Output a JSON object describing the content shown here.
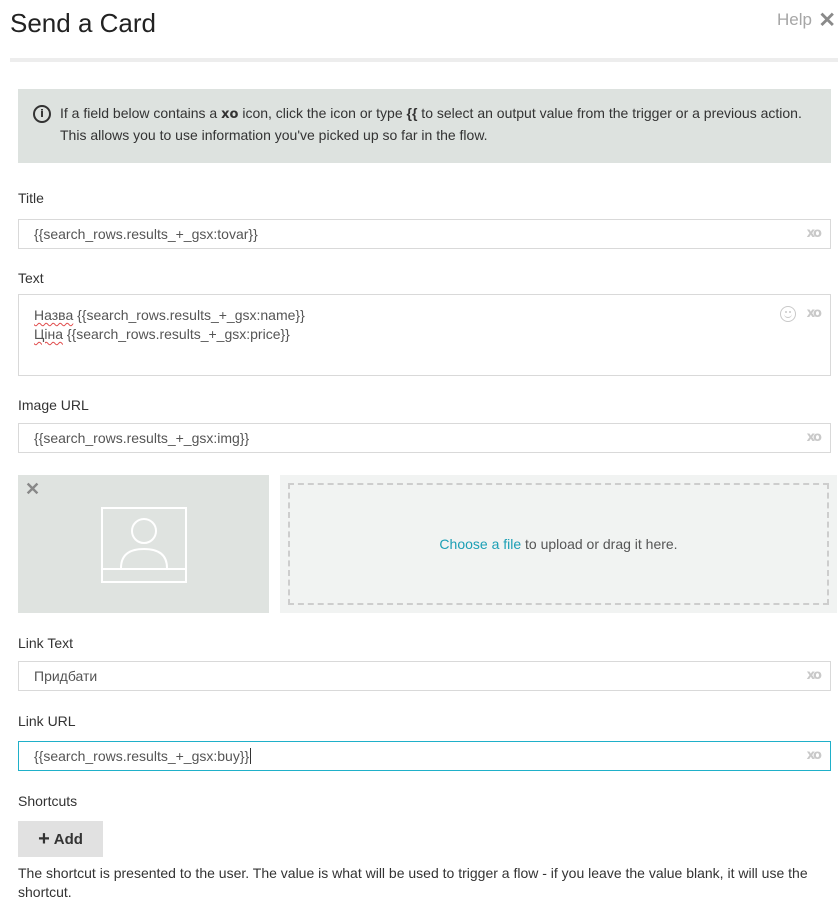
{
  "header": {
    "title": "Send a Card",
    "help_label": "Help",
    "close_symbol": "✕"
  },
  "info": {
    "icon": "info-circle-icon",
    "text_before": "If a field below contains a ",
    "text_middle": " icon, click the icon or type ",
    "token_open": "{{",
    "text_after": " to select an output value from the trigger or a previous action. This allows you to use information you've picked up so far in the flow."
  },
  "fields": {
    "title": {
      "label": "Title",
      "value": "{{search_rows.results_+_gsx:tovar}}"
    },
    "text": {
      "label": "Text",
      "line1_prefix": "Назва",
      "line1_value": " {{search_rows.results_+_gsx:name}}",
      "line2_prefix": "Ціна",
      "line2_value": " {{search_rows.results_+_gsx:price}}"
    },
    "image_url": {
      "label": "Image URL",
      "value": "{{search_rows.results_+_gsx:img}}"
    },
    "link_text": {
      "label": "Link Text",
      "value": "Придбати"
    },
    "link_url": {
      "label": "Link URL",
      "value": "{{search_rows.results_+_gsx:buy}}"
    }
  },
  "upload": {
    "choose_link": "Choose a file",
    "rest_text": " to upload or drag it here."
  },
  "shortcuts": {
    "label": "Shortcuts",
    "add_label": "Add",
    "hint": "The shortcut is presented to the user. The value is what will be used to trigger a flow - if you leave the value blank, it will use the shortcut."
  },
  "icons": {
    "token": "xo",
    "emoji": "smiley-icon",
    "remove": "✕",
    "plus": "+"
  },
  "colors": {
    "accent": "#1fb0c9",
    "link": "#1b9fb5",
    "info_bg": "#dde2df",
    "border": "#d9d9d9"
  }
}
